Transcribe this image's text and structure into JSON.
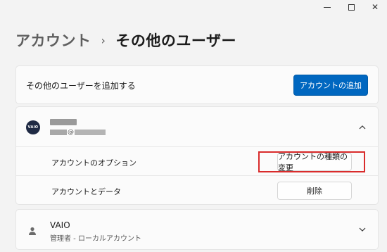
{
  "window": {
    "minimize_glyph": "minimize-icon",
    "maximize_glyph": "maximize-icon",
    "close_glyph": "✕"
  },
  "breadcrumb": {
    "parent": "アカウント",
    "separator": "›",
    "current": "その他のユーザー"
  },
  "add_user": {
    "label": "その他のユーザーを追加する",
    "button": "アカウントの追加"
  },
  "user_card": {
    "avatar_text": "VAIO",
    "email_at": "@",
    "expanded": true,
    "options_label": "アカウントのオプション",
    "options_button": "アカウントの種類の変更",
    "data_label": "アカウントとデータ",
    "data_button": "削除"
  },
  "vaio_account": {
    "name": "VAIO",
    "role": "管理者 - ローカルアカウント",
    "expanded": false
  },
  "colors": {
    "accent": "#0067c0",
    "highlight": "#d92b2b",
    "background": "#f3f3f3",
    "card": "#fbfbfb"
  }
}
